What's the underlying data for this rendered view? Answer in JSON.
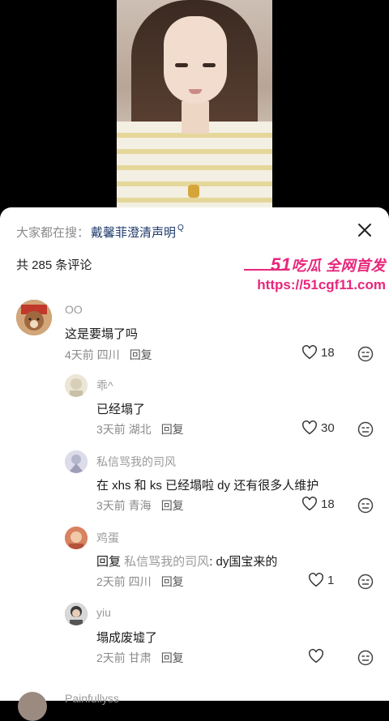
{
  "search": {
    "prefix": "大家都在搜：",
    "term": "戴馨菲澄清声明",
    "mag": "Q"
  },
  "comment_count": "共 285 条评论",
  "watermark": {
    "brand_num": "51",
    "brand_text": "吃瓜 全网首发",
    "url": "https://51cgf11.com"
  },
  "comments": [
    {
      "name": "OO",
      "text": "这是要塌了吗",
      "meta": "4天前 四川",
      "reply": "回复",
      "likes": "18",
      "avatar_color": "#8b5a3c"
    },
    {
      "name": "乖^",
      "text": "已经塌了",
      "meta": "3天前 湖北",
      "reply": "回复",
      "likes": "30",
      "avatar_color": "#e6e0cf"
    },
    {
      "name": "私信骂我的司风",
      "text": "在 xhs 和 ks 已经塌啦 dy 还有很多人维护",
      "meta": "3天前 青海",
      "reply": "回复",
      "likes": "18",
      "avatar_color": "#c8c8d8"
    },
    {
      "name": "鸡蛋",
      "reply_prefix": "回复 ",
      "reply_to": "私信骂我的司风",
      "text": ": dy国宝来的",
      "meta": "2天前 四川",
      "reply": "回复",
      "likes": "1",
      "avatar_color": "#c96a4a"
    },
    {
      "name": "yiu",
      "text": "塌成废墟了",
      "meta": "2天前 甘肃",
      "reply": "回复",
      "likes": "",
      "avatar_color": "#6a6a6a"
    }
  ],
  "cut_comment_name": "Painfullyss"
}
